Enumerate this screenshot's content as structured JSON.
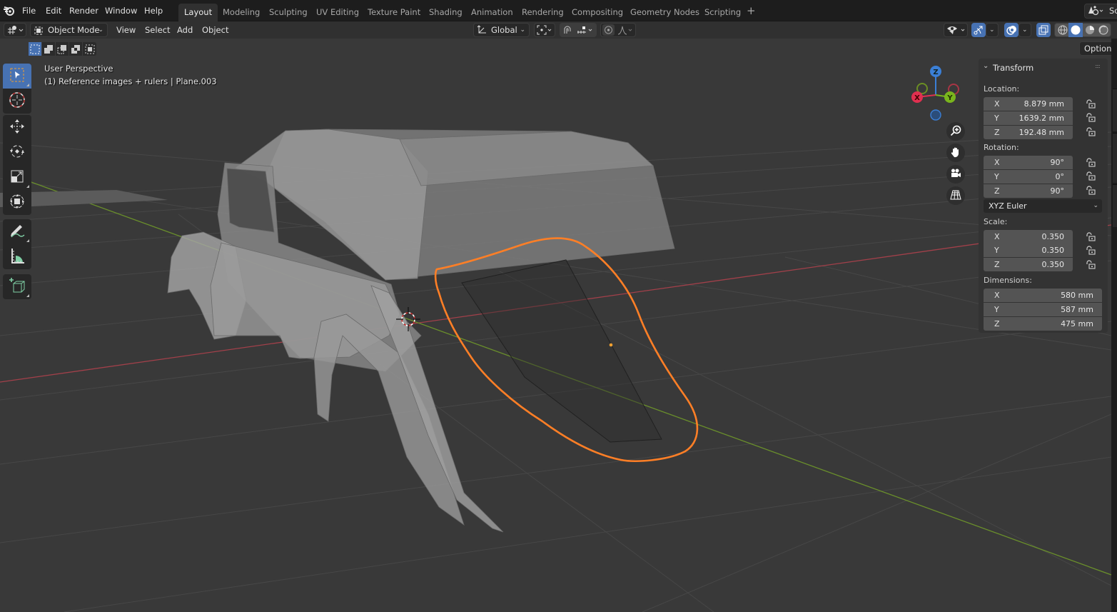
{
  "app": {
    "name": "Blender"
  },
  "top_menu": {
    "items": [
      "File",
      "Edit",
      "Render",
      "Window",
      "Help"
    ],
    "workspaces": [
      "Layout",
      "Modeling",
      "Sculpting",
      "UV Editing",
      "Texture Paint",
      "Shading",
      "Animation",
      "Rendering",
      "Compositing",
      "Geometry Nodes",
      "Scripting"
    ],
    "active_workspace": "Layout",
    "add_workspace_icon": "plus-icon",
    "scene_label": "Sc"
  },
  "header": {
    "editor_type_icon": "3d-viewport-icon",
    "mode": "Object Mode",
    "menus": [
      "View",
      "Select",
      "Add",
      "Object"
    ],
    "transform_orientation": "Global",
    "pivot_icon": "pivot-point-icon",
    "snap_icon": "magnet-icon",
    "snap_target_icon": "snap-increment-icon",
    "proportional_icon": "proportional-edit-icon",
    "falloff_icon": "falloff-curve-icon",
    "visibility_icon": "eye-icon",
    "gizmo_icon": "gizmo-icon",
    "overlay_icon": "overlay-icon",
    "xray_icon": "xray-icon",
    "shading_modes": [
      "wireframe",
      "solid",
      "material-preview",
      "rendered"
    ],
    "active_shading": "solid",
    "options_label": "Options"
  },
  "selection_modes": [
    "new",
    "extend",
    "subtract",
    "difference",
    "intersect"
  ],
  "viewport": {
    "view_name": "User Perspective",
    "object_info": "(1) Reference images + rulers | Plane.003",
    "axis_colors": {
      "x": "#d0404e",
      "y": "#6f9e25",
      "z": "#3b7fd6"
    },
    "annotation_color": "#ff7a1f",
    "gizmo_labels": {
      "x": "X",
      "y": "Y",
      "z": "Z"
    }
  },
  "toolbar": {
    "tools": [
      {
        "name": "select-box",
        "active": true
      },
      {
        "name": "cursor"
      },
      {
        "name": "move"
      },
      {
        "name": "rotate"
      },
      {
        "name": "scale"
      },
      {
        "name": "transform"
      },
      {
        "name": "annotate"
      },
      {
        "name": "measure"
      },
      {
        "name": "add-cube"
      }
    ]
  },
  "nav_buttons": [
    "zoom",
    "pan",
    "camera",
    "perspective-toggle"
  ],
  "npanel": {
    "section_title": "Transform",
    "location": {
      "label": "Location:",
      "x": "8.879 mm",
      "y": "1639.2 mm",
      "z": "192.48 mm"
    },
    "rotation": {
      "label": "Rotation:",
      "x": "90°",
      "y": "0°",
      "z": "90°",
      "mode": "XYZ Euler"
    },
    "scale": {
      "label": "Scale:",
      "x": "0.350",
      "y": "0.350",
      "z": "0.350"
    },
    "dimensions": {
      "label": "Dimensions:",
      "x": "580 mm",
      "y": "587 mm",
      "z": "475 mm"
    },
    "axis_letters": {
      "x": "X",
      "y": "Y",
      "z": "Z"
    }
  }
}
